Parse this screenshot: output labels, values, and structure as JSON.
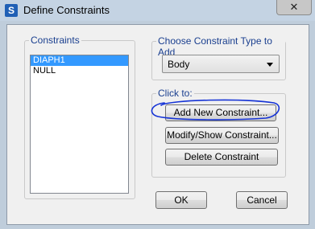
{
  "window": {
    "title": "Define Constraints",
    "app_icon_letter": "S",
    "close_glyph": "✕"
  },
  "constraints": {
    "group_label": "Constraints",
    "items": [
      "DIAPH1",
      "NULL"
    ],
    "selected": "DIAPH1"
  },
  "type_group": {
    "label": "Choose Constraint Type to Add",
    "selected_value": "Body"
  },
  "click_to": {
    "label": "Click to:",
    "add_button": "Add New Constraint...",
    "modify_button": "Modify/Show Constraint...",
    "delete_button": "Delete Constraint"
  },
  "footer": {
    "ok_label": "OK",
    "cancel_label": "Cancel"
  },
  "colors": {
    "selection": "#3399ff",
    "group_label": "#1a3f8f",
    "annotation_circle": "#1533d6"
  },
  "icons": [
    "app-icon",
    "close-icon",
    "chevron-down-icon"
  ]
}
